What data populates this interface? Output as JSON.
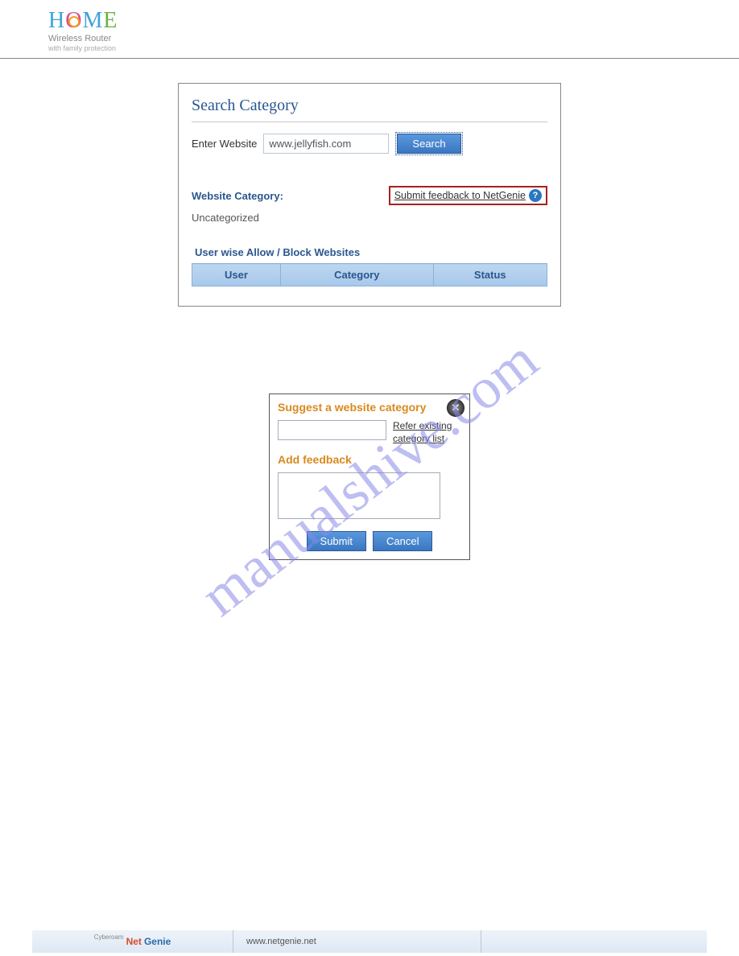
{
  "logo": {
    "title_html_parts": [
      "H",
      "O",
      "M",
      "E"
    ],
    "subtitle": "Wireless  Router",
    "tagline": "with family protection"
  },
  "panel": {
    "title": "Search Category",
    "enter_label": "Enter Website",
    "website_value": "www.jellyfish.com",
    "search_btn": "Search",
    "category_label": "Website Category:",
    "feedback_link": "Submit feedback to NetGenie",
    "category_value": "Uncategorized",
    "userwise_title": "User wise Allow / Block Websites",
    "table_headers": [
      "User",
      "Category",
      "Status"
    ]
  },
  "dialog": {
    "suggest_title": "Suggest a website category",
    "refer_link": "Refer existing category list",
    "feedback_title": "Add feedback",
    "submit_btn": "Submit",
    "cancel_btn": "Cancel"
  },
  "watermark": "manualshive.com",
  "footer": {
    "cyberoam": "Cyberoam",
    "brand_a": "Net",
    "brand_b": "Genie",
    "url": "www.netgenie.net"
  }
}
